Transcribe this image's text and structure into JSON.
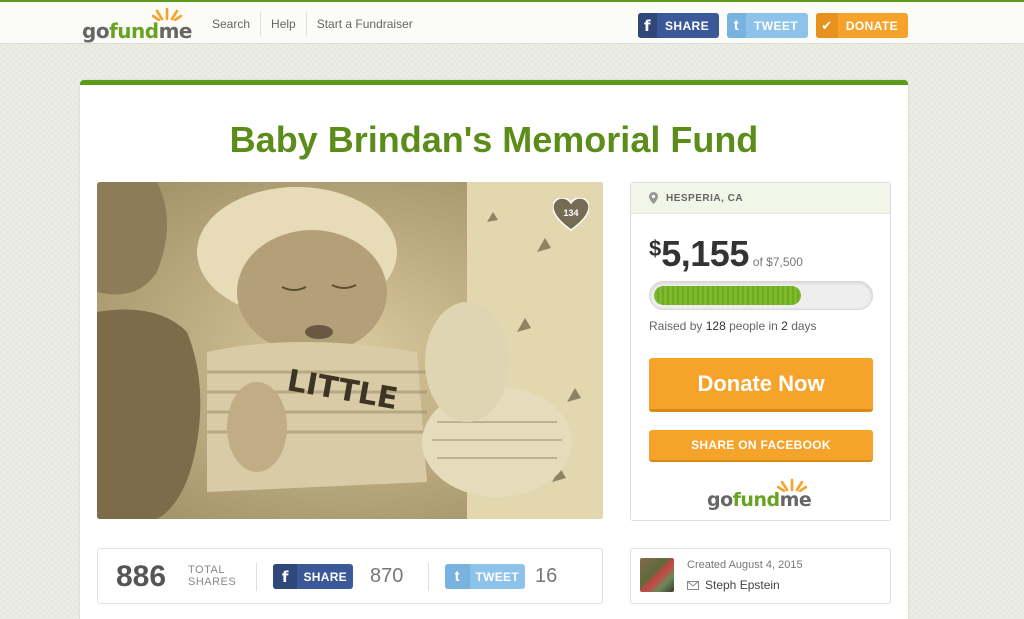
{
  "header": {
    "logo": "gofundme",
    "nav": [
      "Search",
      "Help",
      "Start a Fundraiser"
    ],
    "share_label": "SHARE",
    "tweet_label": "TWEET",
    "donate_label": "DONATE"
  },
  "campaign": {
    "title": "Baby Brindan's Memorial Fund",
    "hearts": "134",
    "location": "HESPERIA, CA",
    "raised_symbol": "$",
    "raised": "5,155",
    "goal": "of $7,500",
    "progress_fraction": 0.687,
    "raised_by_prefix": "Raised by",
    "raised_by_people": "128",
    "raised_by_mid": "people in",
    "raised_by_days": "2",
    "raised_by_suffix": "days",
    "donate_now": "Donate Now",
    "share_facebook": "SHARE ON FACEBOOK",
    "panel_logo": "gofundme"
  },
  "shares": {
    "total": "886",
    "total_label_1": "TOTAL",
    "total_label_2": "SHARES",
    "fb_label": "SHARE",
    "fb_count": "870",
    "tw_label": "TWEET",
    "tw_count": "16"
  },
  "creator": {
    "created": "Created August 4, 2015",
    "name": "Steph Epstein"
  },
  "colors": {
    "brand_green": "#5c9a1b",
    "title_green": "#5c8d1a",
    "orange": "#f5a32a",
    "facebook": "#3b5998",
    "twitter": "#8dc3eb"
  }
}
